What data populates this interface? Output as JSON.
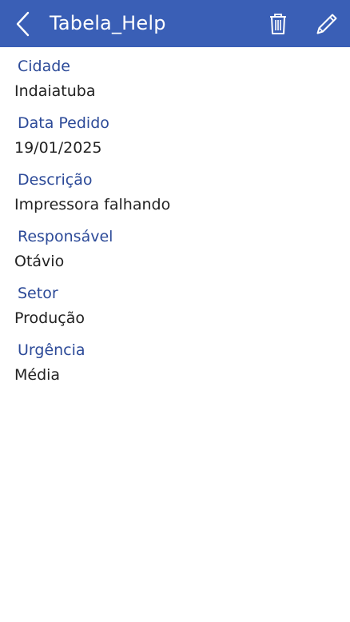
{
  "header": {
    "title": "Tabela_Help",
    "back_icon": "chevron-left-icon",
    "delete_icon": "trash-icon",
    "edit_icon": "pencil-icon",
    "background_color": "#3a5fb6"
  },
  "fields": [
    {
      "label": "Cidade",
      "value": "Indaiatuba"
    },
    {
      "label": "Data Pedido",
      "value": "19/01/2025"
    },
    {
      "label": "Descrição",
      "value": "Impressora falhando"
    },
    {
      "label": "Responsável",
      "value": "Otávio"
    },
    {
      "label": "Setor",
      "value": "Produção"
    },
    {
      "label": "Urgência",
      "value": "Média"
    }
  ],
  "colors": {
    "label": "#2c4a98",
    "value": "#222222"
  }
}
